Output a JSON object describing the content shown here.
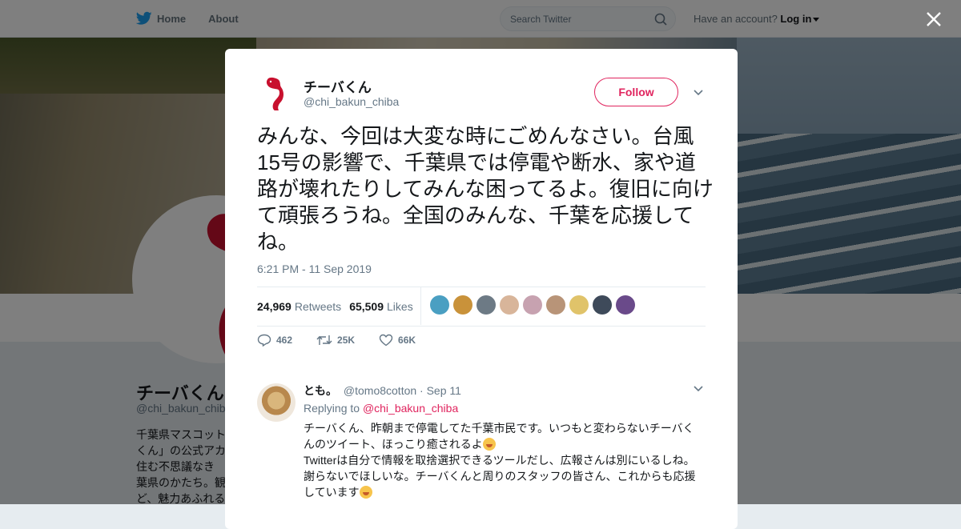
{
  "topbar": {
    "home": "Home",
    "about": "About",
    "search_placeholder": "Search Twitter",
    "account_prompt": "Have an account?",
    "login": "Log in"
  },
  "background_profile": {
    "name": "チーバくん",
    "handle": "@chi_bakun_chiba",
    "bio_lines": [
      "千葉県マスコット",
      "くん」の公式アカ",
      "住む不思議なき",
      "葉県のかたち。観",
      "ど、魅力あふれる"
    ]
  },
  "tweet": {
    "author_name": "チーバくん",
    "author_handle": "@chi_bakun_chiba",
    "follow_label": "Follow",
    "text": "みんな、今回は大変な時にごめんなさい。台風15号の影響で、千葉県では停電や断水、家や道路が壊れたりしてみんな困ってるよ。復旧に向けて頑張ろうね。全国のみんな、千葉を応援してね。",
    "timestamp": "6:21 PM - 11 Sep 2019",
    "retweets_count": "24,969",
    "retweets_label": "Retweets",
    "likes_count": "65,509",
    "likes_label": "Likes",
    "liker_colors": [
      "#4a9fc2",
      "#c9923a",
      "#6d7a85",
      "#d8b59a",
      "#c7a2b0",
      "#b89478",
      "#e0c36a",
      "#3e4a5a",
      "#6a4a8a"
    ],
    "actions": {
      "reply_count": "462",
      "retweet_count": "25K",
      "like_count": "66K"
    }
  },
  "reply": {
    "name": "とも。",
    "handle": "@tomo8cotton",
    "date": "· Sep 11",
    "replying_prefix": "Replying to",
    "replying_to": "@chi_bakun_chiba",
    "line1": "チーバくん、昨朝まで停電してた千葉市民です。いつもと変わらないチーバく",
    "line2": "んのツイート、ほっこり癒されるよ",
    "line3": "Twitterは自分で情報を取捨選択できるツールだし、広報さんは別にいるしね。",
    "line4": "謝らないでほしいな。チーバくんと周りのスタッフの皆さん、これからも応援",
    "line5": "しています"
  },
  "colors": {
    "accent": "#e0245e",
    "twitter_blue": "#1da1f2",
    "text_secondary": "#657786",
    "chiba_red": "#c8102e"
  }
}
